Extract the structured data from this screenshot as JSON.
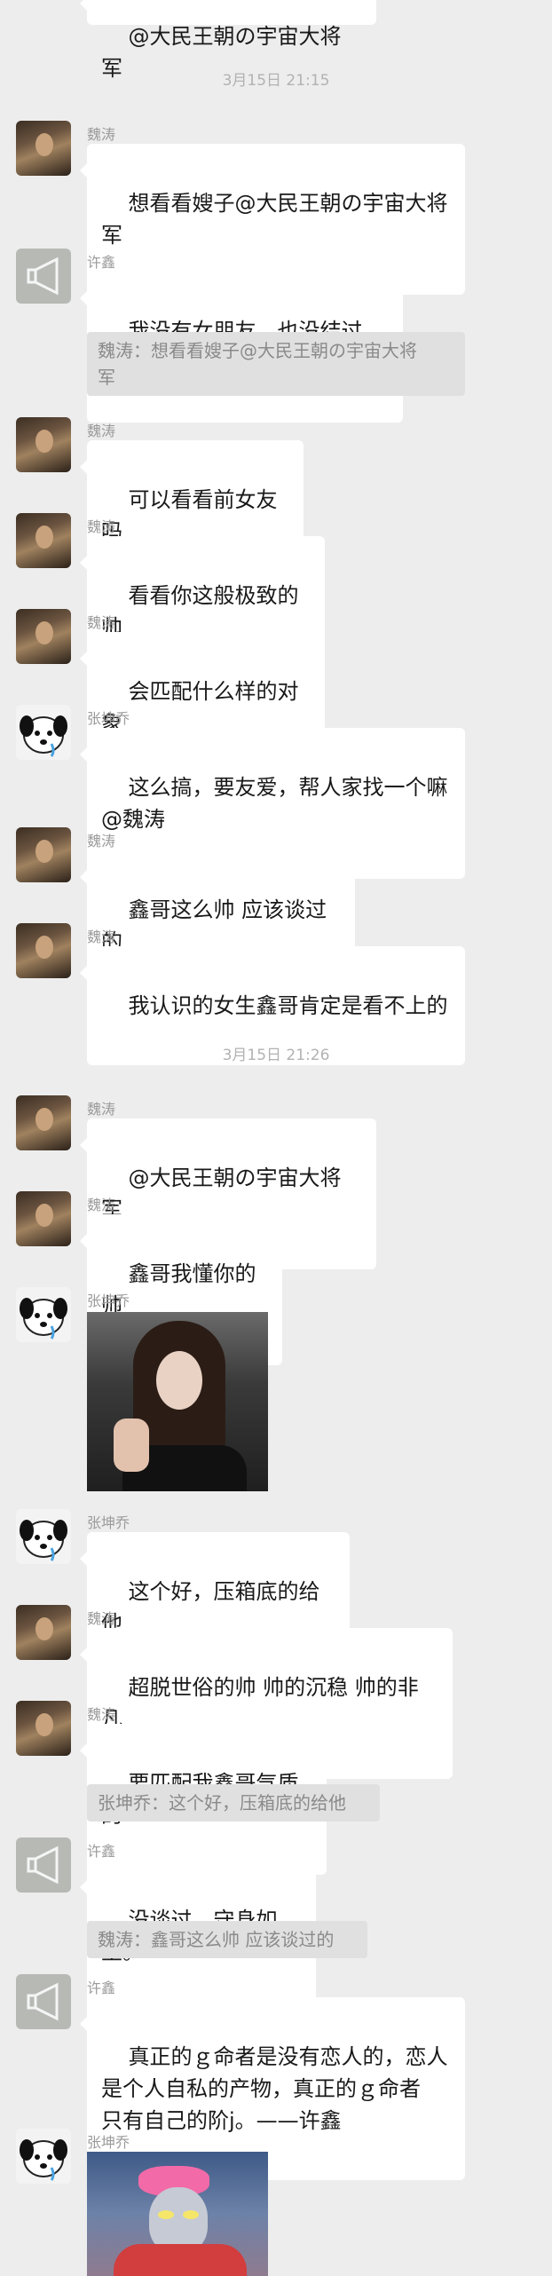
{
  "colors": {
    "background": "#EDEDED",
    "bubble": "#FFFFFF",
    "quote_bg": "#E0E0E0",
    "name_text": "#9A9A9A",
    "timestamp_text": "#B2B2B2"
  },
  "timestamps": [
    "3月15日 21:15",
    "3月15日 21:26"
  ],
  "messages": [
    {
      "text": "@大民王朝の宇宙大将军"
    },
    {
      "sender": "魏涛",
      "text": "想看看嫂子@大民王朝の宇宙大将\n军"
    },
    {
      "sender": "许鑫",
      "text": "我没有女朋友，也没结过婚。",
      "quote": "魏涛：想看看嫂子@大民王朝の宇宙大将\n军"
    },
    {
      "sender": "魏涛",
      "text": "可以看看前女友吗"
    },
    {
      "sender": "魏涛",
      "text": "看看你这般极致的帅"
    },
    {
      "sender": "魏涛",
      "text": "会匹配什么样的对象"
    },
    {
      "sender": "张坤乔",
      "text": "这么搞，要友爱，帮人家找一个嘛\n@魏涛"
    },
    {
      "sender": "魏涛",
      "text": "鑫哥这么帅 应该谈过的"
    },
    {
      "sender": "魏涛",
      "text": "我认识的女生鑫哥肯定是看不上的"
    },
    {
      "sender": "魏涛",
      "text": "@大民王朝の宇宙大将军"
    },
    {
      "sender": "魏涛",
      "text": "鑫哥我懂你的帅"
    },
    {
      "sender": "张坤乔",
      "image": "photo-girl-thumbs-up"
    },
    {
      "sender": "张坤乔",
      "text": "这个好，压箱底的给他"
    },
    {
      "sender": "魏涛",
      "text": "超脱世俗的帅 帅的沉稳 帅的非凡"
    },
    {
      "sender": "魏涛",
      "text": "要匹配我鑫哥气质的",
      "quote": "张坤乔：这个好，压箱底的给他"
    },
    {
      "sender": "许鑫",
      "text": "没谈过，守身如玉。",
      "quote": "魏涛：鑫哥这么帅 应该谈过的"
    },
    {
      "sender": "许鑫",
      "text": "真正的ｇ命者是没有恋人的，恋人\n是个人自私的产物，真正的ｇ命者\n只有自己的阶j。——许鑫"
    },
    {
      "sender": "张坤乔",
      "image": "photo-ultraman-bow"
    }
  ]
}
